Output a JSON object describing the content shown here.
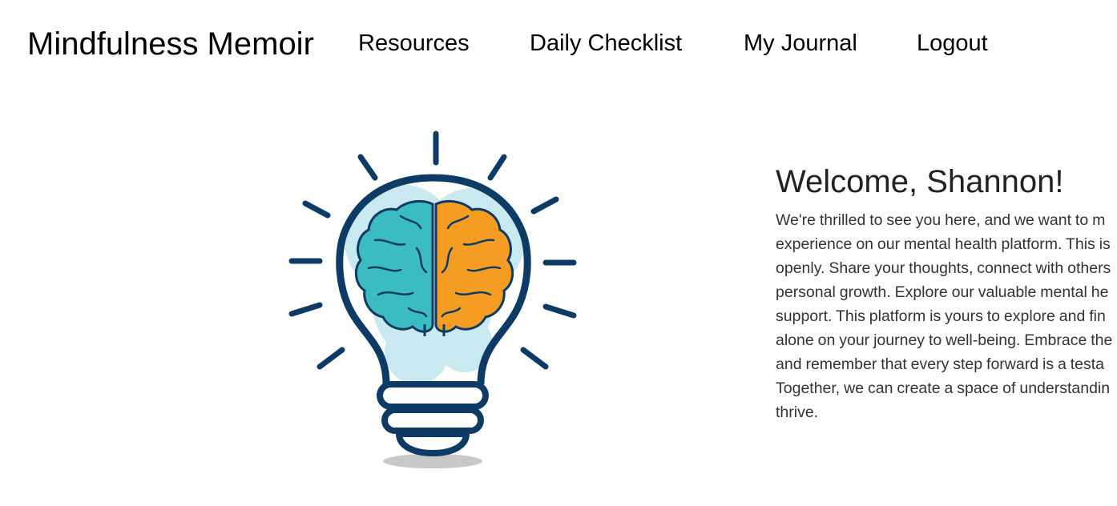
{
  "app": {
    "brand": "Mindfulness Memoir"
  },
  "nav": {
    "items": [
      {
        "label": "Resources"
      },
      {
        "label": "Daily Checklist"
      },
      {
        "label": "My Journal"
      },
      {
        "label": "Logout"
      }
    ]
  },
  "hero": {
    "image_icon": "lightbulb-brain-icon",
    "colors": {
      "outline": "#0d3b66",
      "left_brain": "#3bbcc0",
      "right_brain": "#f59d22",
      "glow": "#9fd6e3",
      "shadow": "#c8c8c8"
    }
  },
  "welcome": {
    "title": "Welcome, Shannon!",
    "lines": [
      "We're thrilled to see you here, and we want to m",
      "experience on our mental health platform. This is",
      "openly. Share your thoughts, connect with others",
      "personal growth. Explore our valuable mental he",
      "support. This platform is yours to explore and fin",
      "alone on your journey to well-being. Embrace the",
      "and remember that every step forward is a testa",
      "Together, we can create a space of understandin",
      "thrive."
    ]
  }
}
